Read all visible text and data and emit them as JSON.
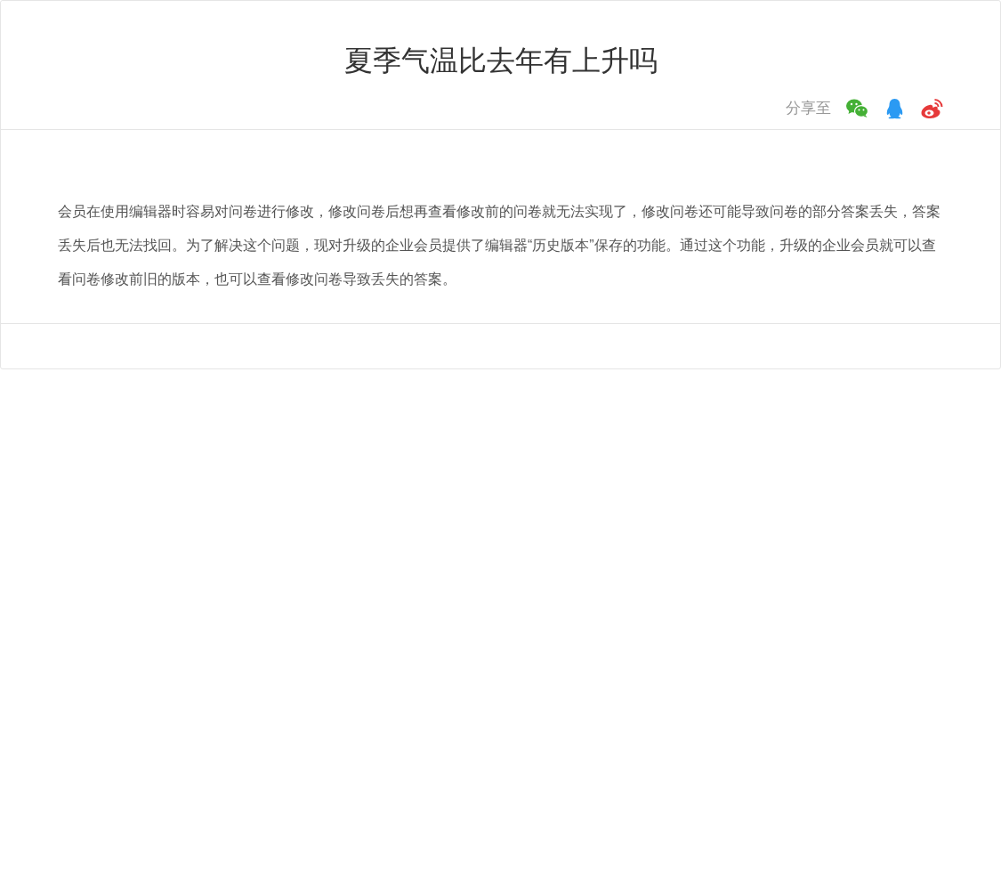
{
  "title": "夏季气温比去年有上升吗",
  "share": {
    "label": "分享至",
    "targets": [
      {
        "kind": "wechat"
      },
      {
        "kind": "qq"
      },
      {
        "kind": "weibo"
      }
    ]
  },
  "body": "会员在使用编辑器时容易对问卷进行修改，修改问卷后想再查看修改前的问卷就无法实现了，修改问卷还可能导致问卷的部分答案丢失，答案丢失后也无法找回。为了解决这个问题，现对升级的企业会员提供了编辑器“历史版本”保存的功能。通过这个功能，升级的企业会员就可以查看问卷修改前旧的版本，也可以查看修改问卷导致丢失的答案。"
}
